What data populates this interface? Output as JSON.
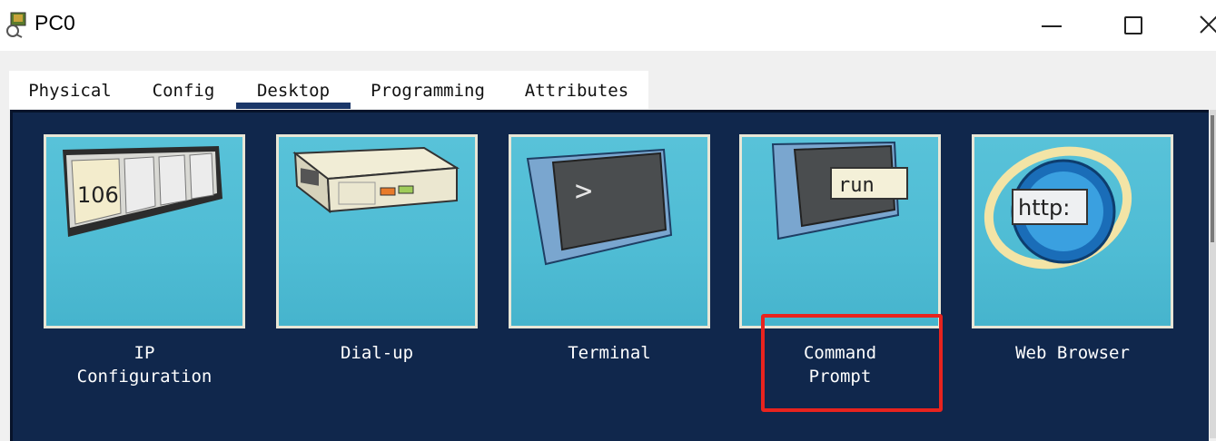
{
  "window": {
    "title": "PC0"
  },
  "tabs": [
    {
      "label": "Physical",
      "active": false
    },
    {
      "label": "Config",
      "active": false
    },
    {
      "label": "Desktop",
      "active": true
    },
    {
      "label": "Programming",
      "active": false
    },
    {
      "label": "Attributes",
      "active": false
    }
  ],
  "desktop": {
    "apps": [
      {
        "label": "IP\nConfiguration",
        "icon": "ip-configuration-icon",
        "icon_text": "106"
      },
      {
        "label": "Dial-up",
        "icon": "modem-icon"
      },
      {
        "label": "Terminal",
        "icon": "terminal-icon",
        "icon_text": ">"
      },
      {
        "label": "Command\nPrompt",
        "icon": "command-prompt-icon",
        "icon_text": "run"
      },
      {
        "label": "Web Browser",
        "icon": "web-browser-icon",
        "icon_text": "http:"
      }
    ]
  },
  "colors": {
    "desktop_bg": "#10274c",
    "tile_bg": "#4fbcd4",
    "highlight": "#e8231e",
    "active_tab_underline": "#1a3668"
  }
}
